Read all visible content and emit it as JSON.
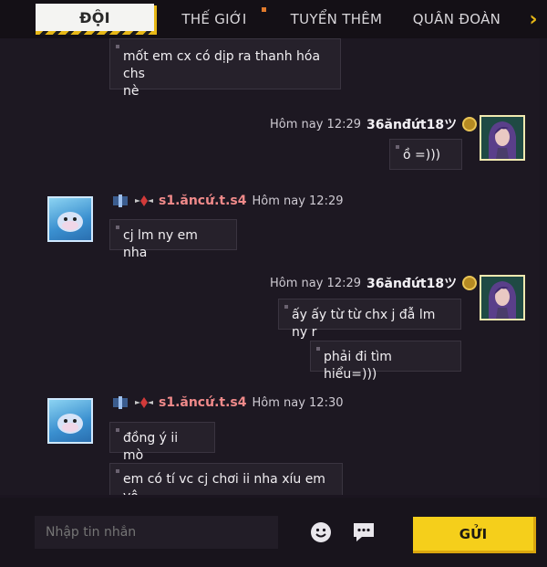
{
  "tabs": [
    {
      "label": "ĐỘI",
      "active": true
    },
    {
      "label": "THẾ GIỚI"
    },
    {
      "label": "TUYỂN THÊM"
    },
    {
      "label": "QUÂN ĐOÀN"
    }
  ],
  "messages": [
    {
      "side": "left",
      "text": "mốt em cx có dịp ra thanh hóa chs\nnè"
    },
    {
      "side": "right",
      "time": "Hôm nay 12:29",
      "sender": "36ănđứt18ツ",
      "texts": [
        "ồ =)))"
      ]
    },
    {
      "side": "left",
      "sender": "s1.ăncứ.t.s4",
      "time": "Hôm nay 12:29",
      "texts": [
        "cj lm ny em nha"
      ]
    },
    {
      "side": "right",
      "time": "Hôm nay 12:29",
      "sender": "36ănđứt18ツ",
      "texts": [
        "ấy ấy từ từ chx j đẫ lm ny r",
        "phải đi tìm hiểu=)))"
      ]
    },
    {
      "side": "left",
      "sender": "s1.ăncứ.t.s4",
      "time": "Hôm nay 12:30",
      "texts": [
        "đồng ý ii mò",
        "em có tí vc cj chơi ii nha xíu em vô"
      ]
    }
  ],
  "input": {
    "placeholder": "Nhập tin nhắn",
    "value": ""
  },
  "send_label": "GỬI",
  "icons": {
    "emoji": "smiley-icon",
    "quick_chat": "chat-bubble-icon",
    "next_tab": "chevron-right-icon"
  },
  "colors": {
    "accent": "#f5cf1b",
    "bubble": "#26212b",
    "background": "#1d1822"
  }
}
